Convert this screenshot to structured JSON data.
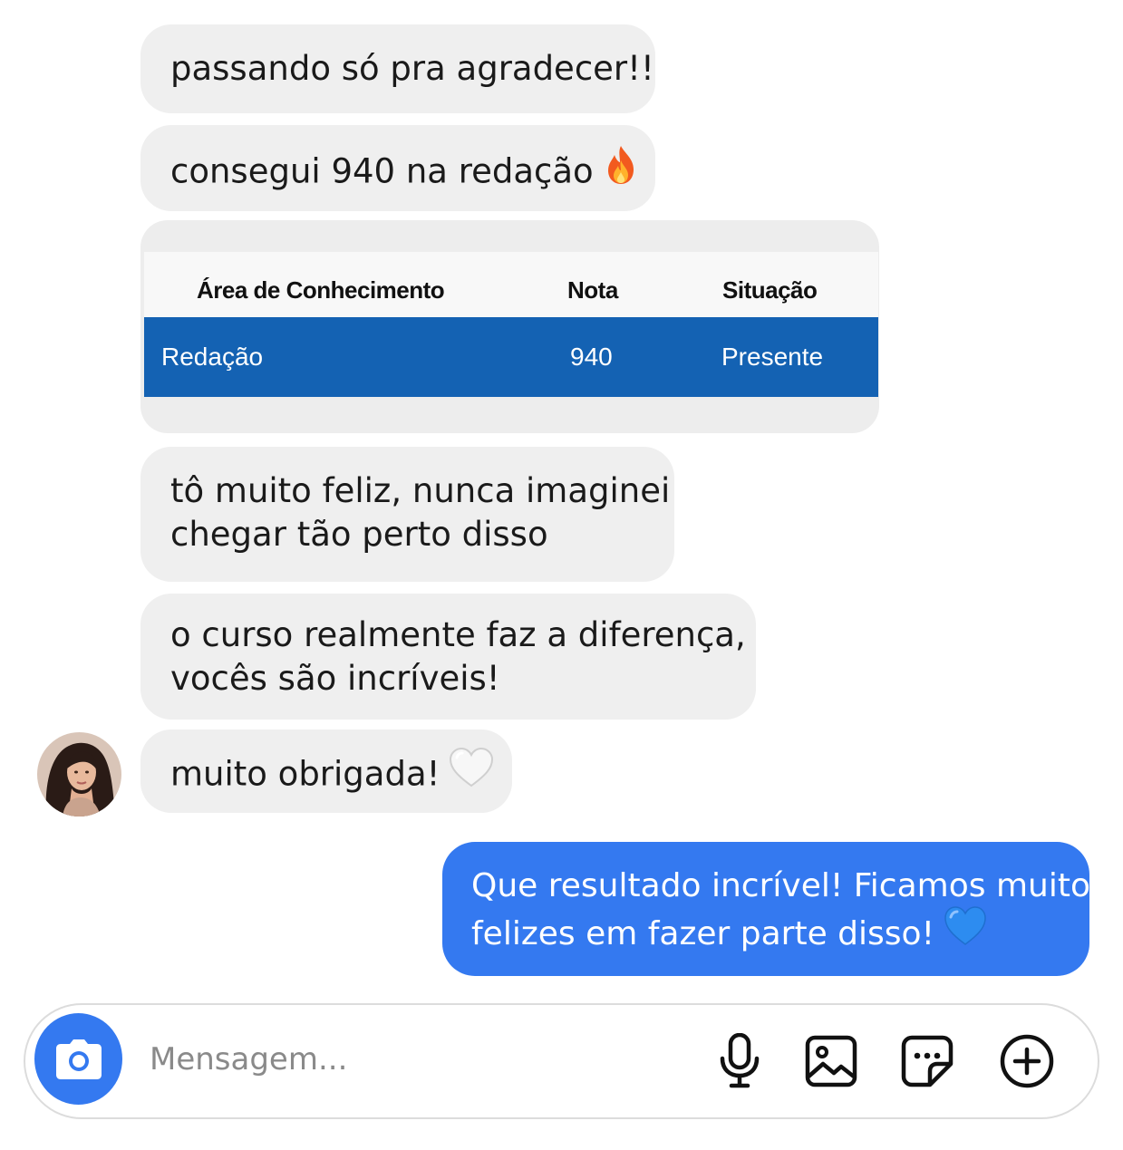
{
  "messages": {
    "received": [
      {
        "lines": [
          "passando só pra agradecer!!"
        ]
      },
      {
        "lines": [
          "consegui 940 na redação"
        ],
        "emoji": "fire-emoji"
      },
      {
        "lines": [
          "tô muito feliz, nunca imaginei",
          "chegar tão perto disso"
        ]
      },
      {
        "lines": [
          "o curso realmente faz a diferença,",
          "vocês são incríveis!"
        ]
      },
      {
        "lines": [
          "muito obrigada!"
        ],
        "emoji": "white-heart-emoji"
      }
    ],
    "sent": {
      "lines": [
        "Que resultado incrível! Ficamos muito",
        "felizes em fazer parte disso!"
      ],
      "emoji": "blue-heart-emoji"
    }
  },
  "grade_table": {
    "headers": [
      "Área de Conhecimento",
      "Nota",
      "Situação"
    ],
    "row": [
      "Redação",
      "940",
      "Presente"
    ],
    "row_color": "#1462b3"
  },
  "composer": {
    "placeholder": "Mensagem...",
    "icons": [
      "camera-icon",
      "microphone-icon",
      "gallery-icon",
      "sticker-icon",
      "plus-icon"
    ]
  },
  "colors": {
    "received_bubble": "#efefef",
    "sent_bubble": "#3479f0",
    "accent": "#3479f0"
  }
}
